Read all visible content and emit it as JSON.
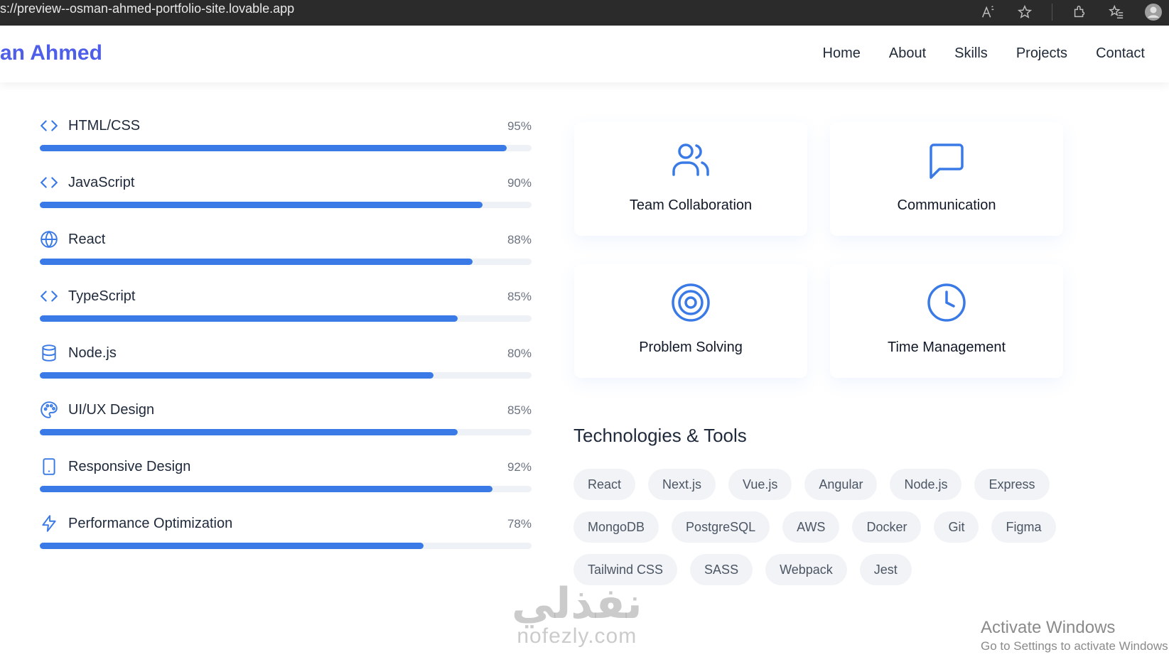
{
  "browser": {
    "url": "s://preview--osman-ahmed-portfolio-site.lovable.app"
  },
  "header": {
    "logo": "an Ahmed",
    "nav": [
      "Home",
      "About",
      "Skills",
      "Projects",
      "Contact"
    ]
  },
  "skills": [
    {
      "name": "HTML/CSS",
      "percent_label": "95%",
      "level": 95,
      "icon": "code-icon"
    },
    {
      "name": "JavaScript",
      "percent_label": "90%",
      "level": 90,
      "icon": "code-icon"
    },
    {
      "name": "React",
      "percent_label": "88%",
      "level": 88,
      "icon": "globe-icon"
    },
    {
      "name": "TypeScript",
      "percent_label": "85%",
      "level": 85,
      "icon": "code-icon"
    },
    {
      "name": "Node.js",
      "percent_label": "80%",
      "level": 80,
      "icon": "database-icon"
    },
    {
      "name": "UI/UX Design",
      "percent_label": "85%",
      "level": 85,
      "icon": "palette-icon"
    },
    {
      "name": "Responsive Design",
      "percent_label": "92%",
      "level": 92,
      "icon": "tablet-icon"
    },
    {
      "name": "Performance Optimization",
      "percent_label": "78%",
      "level": 78,
      "icon": "lightning-icon"
    }
  ],
  "soft_skills": [
    {
      "label": "Team Collaboration",
      "icon": "users-icon"
    },
    {
      "label": "Communication",
      "icon": "message-square-icon"
    },
    {
      "label": "Problem Solving",
      "icon": "target-icon"
    },
    {
      "label": "Time Management",
      "icon": "clock-icon"
    }
  ],
  "technologies": {
    "title": "Technologies & Tools",
    "tags": [
      "React",
      "Next.js",
      "Vue.js",
      "Angular",
      "Node.js",
      "Express",
      "MongoDB",
      "PostgreSQL",
      "AWS",
      "Docker",
      "Git",
      "Figma",
      "Tailwind CSS",
      "SASS",
      "Webpack",
      "Jest"
    ]
  },
  "overlays": {
    "watermark_ar": "نفذلي",
    "watermark_en": "nofezly.com",
    "activate_title": "Activate Windows",
    "activate_sub": "Go to Settings to activate Windows."
  },
  "colors": {
    "accent": "#3a7ae6",
    "logo": "#4f5ee8",
    "track": "#eef1f5"
  }
}
